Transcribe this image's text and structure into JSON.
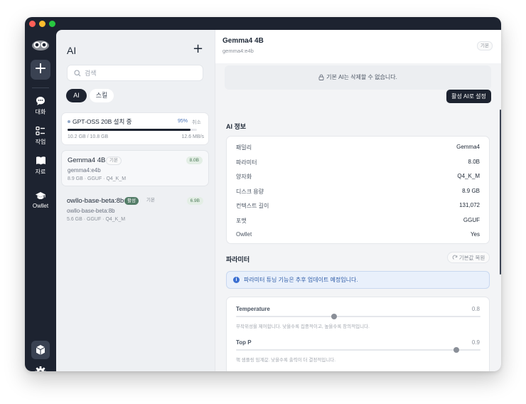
{
  "rail": {
    "items": [
      {
        "label": "대화",
        "icon": "chat-icon"
      },
      {
        "label": "작업",
        "icon": "checklist-icon"
      },
      {
        "label": "자료",
        "icon": "book-icon"
      },
      {
        "label": "Owllet",
        "icon": "graduation-cap-icon"
      }
    ]
  },
  "left": {
    "title": "AI",
    "search_placeholder": "검색",
    "chips": [
      "AI",
      "스킬"
    ],
    "install": {
      "title": "GPT-OSS 20B 설치 중",
      "percent": "95%",
      "progress": 0.95,
      "cancel": "취소",
      "size": "10.2 GB / 10.8 GB",
      "speed": "12.6 MB/s"
    },
    "models": [
      {
        "name": "Gemma4 4B",
        "default_tag": "기본",
        "active_tag": "",
        "id": "gemma4:e4b",
        "meta": "8.9 GB · GGUF · Q4_K_M",
        "size_badge": "8.0B"
      },
      {
        "name": "owllo-base-beta:8b",
        "default_tag": "기본",
        "active_tag": "활성",
        "id": "owllo-base-beta:8b",
        "meta": "5.6 GB · GGUF · Q4_K_M",
        "size_badge": "6.9B"
      }
    ]
  },
  "detail": {
    "title": "Gemma4 4B",
    "subtitle": "gemma4:e4b",
    "default_tag": "기본",
    "notice": "기본 AI는 삭제할 수 없습니다.",
    "set_active": "활성 AI로 설정",
    "info_title": "AI 정보",
    "info_rows": [
      {
        "k": "패밀리",
        "v": "Gemma4"
      },
      {
        "k": "파라미터",
        "v": "8.0B"
      },
      {
        "k": "양자화",
        "v": "Q4_K_M"
      },
      {
        "k": "디스크 용량",
        "v": "8.9 GB"
      },
      {
        "k": "컨텍스트 길이",
        "v": "131,072"
      },
      {
        "k": "포맷",
        "v": "GGUF"
      },
      {
        "k": "Owllet",
        "v": "Yes"
      }
    ],
    "params_title": "파라미터",
    "reset": "기본값 복원",
    "alert": "파라미터 튜닝 기능은 추후 업데이트 예정입니다.",
    "params": [
      {
        "name": "Temperature",
        "value": "0.8",
        "fraction": 0.4,
        "desc": "무작위성을 제어합니다. 낮을수록 집중적이고, 높을수록 창의적입니다."
      },
      {
        "name": "Top P",
        "value": "0.9",
        "fraction": 0.9,
        "desc": "핵 샘플링 임계값. 낮을수록 출력이 더 결정적입니다."
      }
    ]
  }
}
